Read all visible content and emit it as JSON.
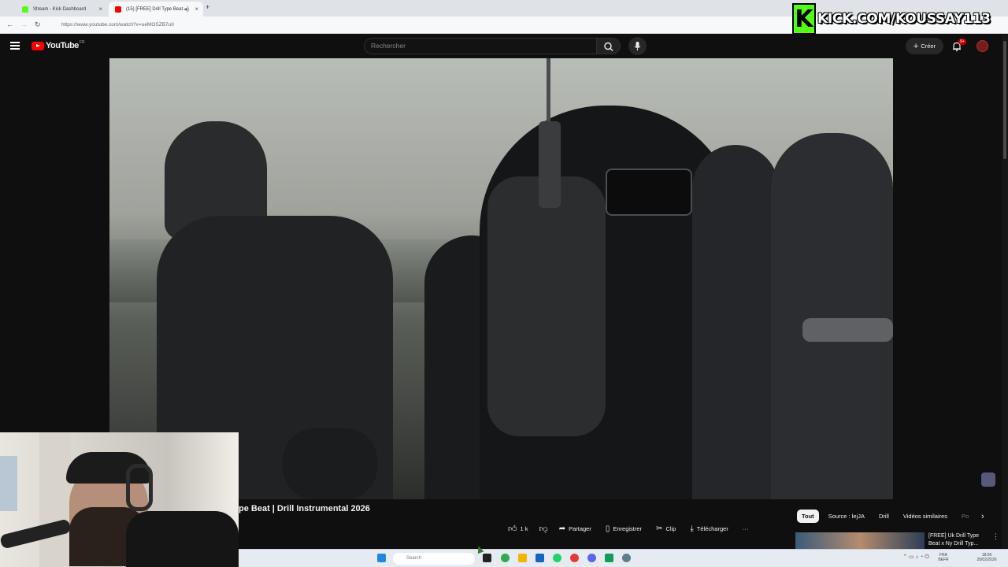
{
  "browser": {
    "tabs": [
      {
        "label": "Stream - Kick Dashboard",
        "favicon_color": "#53fc18",
        "active": false
      },
      {
        "label": "(15) [FREE] Drill Type Beat",
        "favicon_color": "#ff0000",
        "active": true
      }
    ],
    "new_tab": "+",
    "url": "https://www.youtube.com/watch?v=ueMOSZB7uII"
  },
  "overlay": {
    "logo_letter": "K",
    "text": "KICK.COM/KOUSSAY113"
  },
  "youtube": {
    "logo_text": "YouTube",
    "region": "FR",
    "search_placeholder": "Rechercher",
    "create_label": "Créer",
    "notification_count": "9+",
    "video_title": "pe Beat | Drill Instrumental 2026",
    "actions": {
      "like_count": "1 k",
      "share": "Partager",
      "save": "Enregistrer",
      "clip": "Clip",
      "download": "Télécharger",
      "more": "···"
    },
    "chips": [
      "Tout",
      "Source : lejJA",
      "Drill",
      "Vidéos similaires",
      "Po"
    ],
    "recommended": {
      "title": "[FREE] Uk Drill Type Beat x Ny Drill Typ..."
    }
  },
  "taskbar": {
    "search_placeholder": "Search",
    "lang_top": "FRA",
    "lang_bottom": "BEFR",
    "time": "18:06",
    "date": "20/02/2026"
  },
  "colors": {
    "yt_bg": "#0f0f0f",
    "yt_red": "#ff0000",
    "kick_green": "#53fc18"
  }
}
